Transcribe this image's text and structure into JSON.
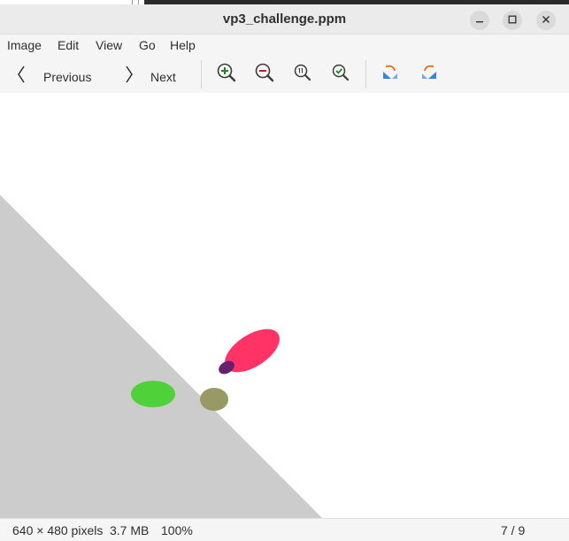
{
  "window": {
    "title": "vp3_challenge.ppm",
    "minimize_icon": "minimize-icon",
    "maximize_icon": "maximize-icon",
    "close_icon": "close-icon"
  },
  "menubar": {
    "items": [
      {
        "label": "Image"
      },
      {
        "label": "Edit"
      },
      {
        "label": "View"
      },
      {
        "label": "Go"
      },
      {
        "label": "Help"
      }
    ]
  },
  "toolbar": {
    "previous_label": "Previous",
    "next_label": "Next",
    "icons": [
      "zoom-in-icon",
      "zoom-out-icon",
      "zoom-normal-icon",
      "zoom-fit-icon",
      "rotate-left-icon",
      "rotate-right-icon"
    ]
  },
  "colors": {
    "ground": "#cccccc",
    "pink_ellipse": "#ff3366",
    "purple_ellipse": "#6a1f6e",
    "green_ellipse": "#4fd13a",
    "olive_ellipse": "#999966",
    "zoom_in_accent": "#1a8a1a",
    "zoom_out_accent": "#c01c28",
    "rotate_accent_blue": "#3584e4",
    "rotate_accent_orange": "#e66100"
  },
  "status": {
    "dimensions": "640 × 480 pixels",
    "filesize": "3.7 MB",
    "zoom": "100%",
    "position": "7 / 9"
  }
}
